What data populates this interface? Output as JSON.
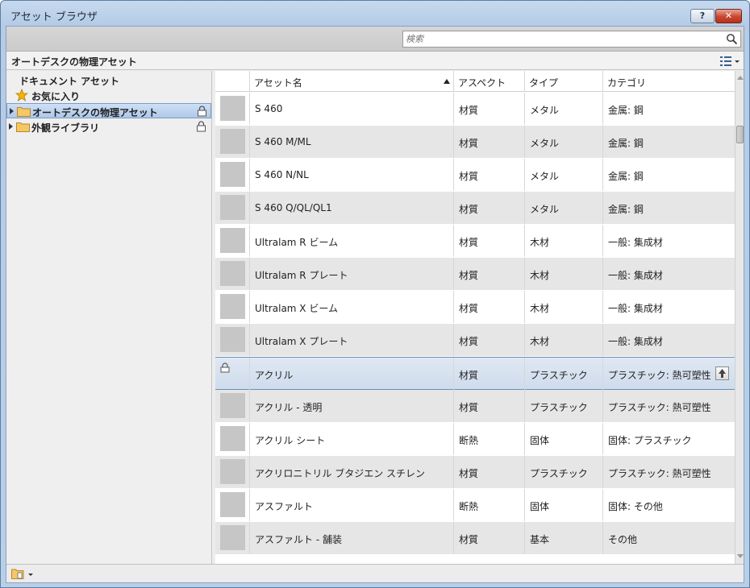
{
  "window": {
    "title": "アセット ブラウザ",
    "help_label": "?",
    "close_label": "✕"
  },
  "search": {
    "placeholder": "検索"
  },
  "library_header": {
    "title": "オートデスクの物理アセット"
  },
  "tree": {
    "document_assets": "ドキュメント アセット",
    "favorites": "お気に入り",
    "autodesk_physical": "オートデスクの物理アセット",
    "appearance_library": "外観ライブラリ"
  },
  "columns": {
    "name": "アセット名",
    "aspect": "アスペクト",
    "type": "タイプ",
    "category": "カテゴリ"
  },
  "rows": [
    {
      "name": "S 460",
      "aspect": "材質",
      "type": "メタル",
      "category": "金属: 鋼"
    },
    {
      "name": "S 460  M/ML",
      "aspect": "材質",
      "type": "メタル",
      "category": "金属: 鋼"
    },
    {
      "name": "S 460  N/NL",
      "aspect": "材質",
      "type": "メタル",
      "category": "金属: 鋼"
    },
    {
      "name": "S 460 Q/QL/QL1",
      "aspect": "材質",
      "type": "メタル",
      "category": "金属: 鋼"
    },
    {
      "name": "Ultralam R ビーム",
      "aspect": "材質",
      "type": "木材",
      "category": "一般: 集成材"
    },
    {
      "name": "Ultralam R プレート",
      "aspect": "材質",
      "type": "木材",
      "category": "一般: 集成材"
    },
    {
      "name": "Ultralam X ビーム",
      "aspect": "材質",
      "type": "木材",
      "category": "一般: 集成材"
    },
    {
      "name": "Ultralam X プレート",
      "aspect": "材質",
      "type": "木材",
      "category": "一般: 集成材"
    },
    {
      "name": "アクリル",
      "aspect": "材質",
      "type": "プラスチック",
      "category": "プラスチック: 熱可塑性"
    },
    {
      "name": "アクリル - 透明",
      "aspect": "材質",
      "type": "プラスチック",
      "category": "プラスチック: 熱可塑性"
    },
    {
      "name": "アクリル シート",
      "aspect": "断熱",
      "type": "固体",
      "category": "固体: プラスチック"
    },
    {
      "name": "アクリロニトリル ブタジエン スチレン",
      "aspect": "材質",
      "type": "プラスチック",
      "category": "プラスチック: 熱可塑性"
    },
    {
      "name": "アスファルト",
      "aspect": "断熱",
      "type": "固体",
      "category": "固体: その他"
    },
    {
      "name": "アスファルト - 舗装",
      "aspect": "材質",
      "type": "基本",
      "category": "その他"
    }
  ]
}
